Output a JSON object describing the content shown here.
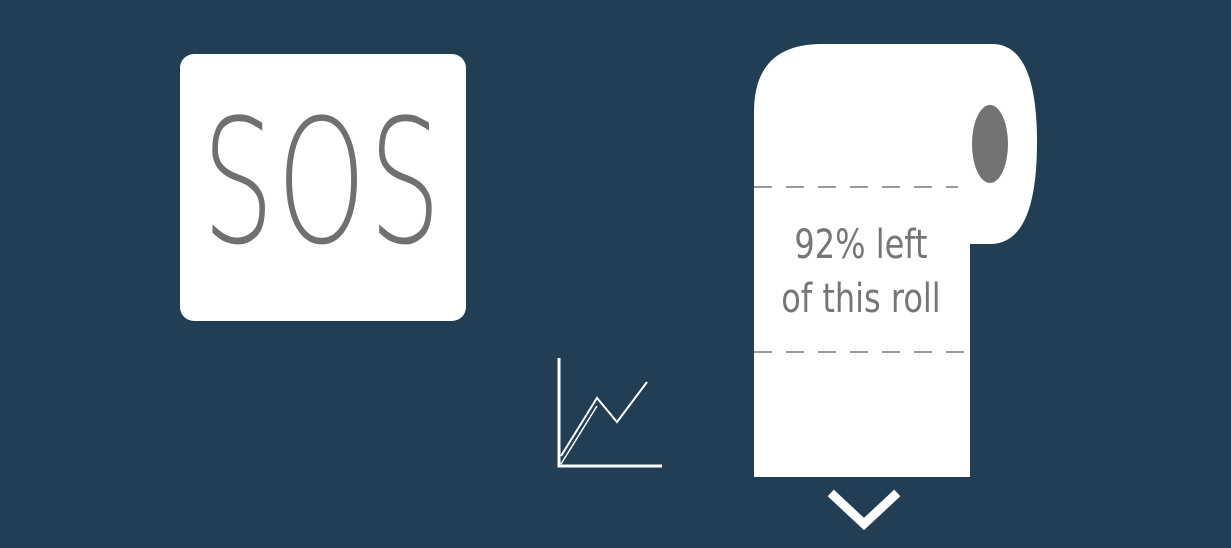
{
  "sos_tile": {
    "label": "SOS"
  },
  "roll": {
    "line1": "92% left",
    "line2": "of this roll",
    "remaining_percent": 92
  },
  "icons": {
    "chart": "line-chart-icon",
    "scroll": "chevron-down-icon"
  },
  "colors": {
    "background": "#223e55",
    "tile": "#ffffff",
    "text": "#707070"
  }
}
